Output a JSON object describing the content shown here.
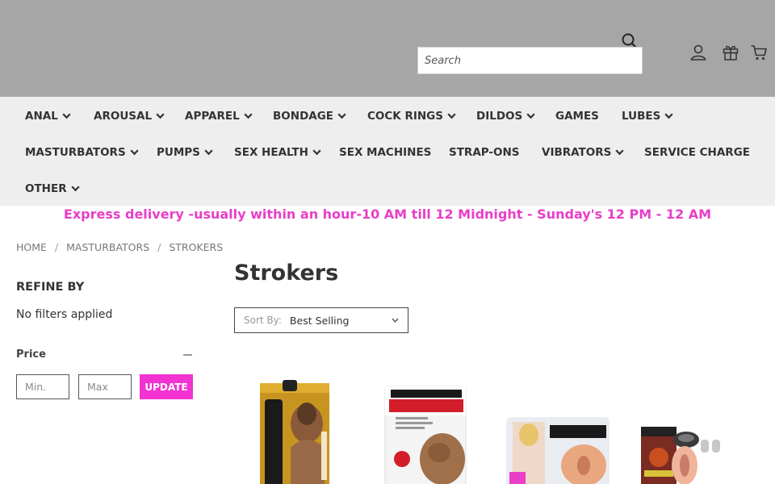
{
  "header": {
    "search": {
      "placeholder": "Search"
    },
    "icons": [
      "search-icon",
      "account-icon",
      "gift-icon",
      "cart-icon"
    ]
  },
  "nav": {
    "items": [
      {
        "label": "ANAL",
        "dropdown": true
      },
      {
        "label": "AROUSAL",
        "dropdown": true
      },
      {
        "label": "APPAREL",
        "dropdown": true
      },
      {
        "label": "BONDAGE",
        "dropdown": true
      },
      {
        "label": "COCK RINGS",
        "dropdown": true
      },
      {
        "label": "DILDOS",
        "dropdown": true
      },
      {
        "label": "GAMES",
        "dropdown": false
      },
      {
        "label": "LUBES",
        "dropdown": true
      },
      {
        "label": "MASTURBATORS",
        "dropdown": true
      },
      {
        "label": "PUMPS",
        "dropdown": true
      },
      {
        "label": "SEX HEALTH",
        "dropdown": true
      },
      {
        "label": "SEX MACHINES",
        "dropdown": false
      },
      {
        "label": "STRAP-ONS",
        "dropdown": false
      },
      {
        "label": "VIBRATORS",
        "dropdown": true
      },
      {
        "label": "SERVICE CHARGE",
        "dropdown": false
      },
      {
        "label": "OTHER",
        "dropdown": true
      }
    ]
  },
  "promo": {
    "text": "Express delivery -usually within an hour-10 AM till 12 Midnight - Sunday's 12 PM - 12 AM",
    "color": "#e83ec8"
  },
  "breadcrumb": {
    "items": [
      "HOME",
      "MASTURBATORS",
      "STROKERS"
    ]
  },
  "page": {
    "title": "Strokers"
  },
  "sidebar": {
    "refine_title": "REFINE BY",
    "no_filters": "No filters applied",
    "price": {
      "label": "Price",
      "min_placeholder": "Min.",
      "max_placeholder": "Max",
      "update_label": "UPDATE"
    }
  },
  "sort": {
    "label": "Sort By:",
    "value": "Best Selling"
  },
  "products": [
    {
      "image": "stroker-product-1"
    },
    {
      "image": "pipedream-extreme-product"
    },
    {
      "image": "mistress-product"
    },
    {
      "image": "vibrating-pussy-product"
    }
  ],
  "colors": {
    "accent": "#f233d1",
    "header_bg": "#a6a6a6",
    "nav_bg": "#eeeeee"
  }
}
